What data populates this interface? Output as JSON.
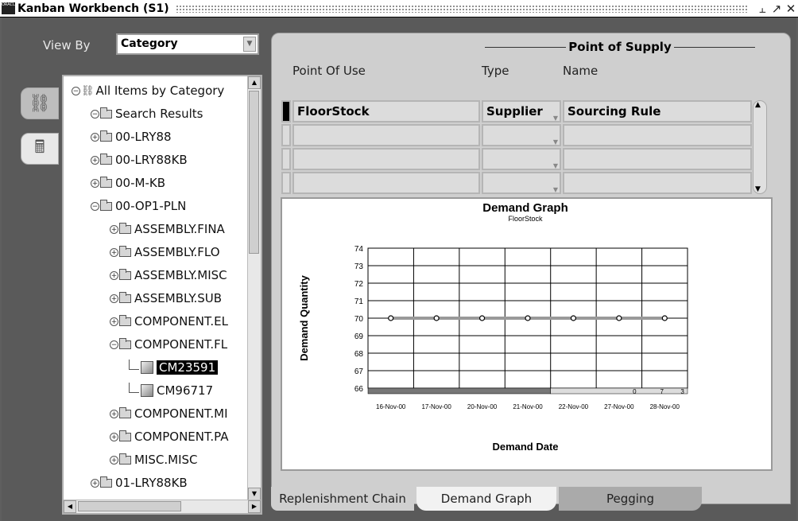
{
  "window": {
    "title": "Kanban Workbench (S1)",
    "logo_text": "ORACLE",
    "buttons": [
      "minimize",
      "restore",
      "close"
    ]
  },
  "view_by": {
    "label": "View By",
    "value": "Category"
  },
  "tree": {
    "items": [
      {
        "label": "All Items by Category",
        "indent": 0,
        "type": "root",
        "expander": "−"
      },
      {
        "label": "Search Results",
        "indent": 1,
        "type": "folder",
        "expander": "−"
      },
      {
        "label": "00-LRY88",
        "indent": 1,
        "type": "folder",
        "expander": "+"
      },
      {
        "label": "00-LRY88KB",
        "indent": 1,
        "type": "folder",
        "expander": "+"
      },
      {
        "label": "00-M-KB",
        "indent": 1,
        "type": "folder",
        "expander": "+"
      },
      {
        "label": "00-OP1-PLN",
        "indent": 1,
        "type": "folder",
        "expander": "−"
      },
      {
        "label": "ASSEMBLY.FINA",
        "indent": 2,
        "type": "folder",
        "expander": "+"
      },
      {
        "label": "ASSEMBLY.FLO",
        "indent": 2,
        "type": "folder",
        "expander": "+"
      },
      {
        "label": "ASSEMBLY.MISC",
        "indent": 2,
        "type": "folder",
        "expander": "+"
      },
      {
        "label": "ASSEMBLY.SUB",
        "indent": 2,
        "type": "folder",
        "expander": "+"
      },
      {
        "label": "COMPONENT.EL",
        "indent": 2,
        "type": "folder",
        "expander": "+"
      },
      {
        "label": "COMPONENT.FL",
        "indent": 2,
        "type": "folder",
        "expander": "−"
      },
      {
        "label": "CM23591",
        "indent": 3,
        "type": "item",
        "expander": "",
        "selected": true
      },
      {
        "label": "CM96717",
        "indent": 3,
        "type": "item",
        "expander": ""
      },
      {
        "label": "COMPONENT.MI",
        "indent": 2,
        "type": "folder",
        "expander": "+"
      },
      {
        "label": "COMPONENT.PA",
        "indent": 2,
        "type": "folder",
        "expander": "+"
      },
      {
        "label": "MISC.MISC",
        "indent": 2,
        "type": "folder",
        "expander": "+"
      },
      {
        "label": "01-LRY88KB",
        "indent": 1,
        "type": "folder",
        "expander": "+"
      }
    ]
  },
  "supply": {
    "group_header": "Point of Supply",
    "col_point_of_use": "Point Of Use",
    "col_type": "Type",
    "col_name": "Name",
    "rows": [
      {
        "point_of_use": "FloorStock",
        "type": "Supplier",
        "name": "Sourcing Rule"
      },
      {
        "point_of_use": "",
        "type": "",
        "name": ""
      },
      {
        "point_of_use": "",
        "type": "",
        "name": ""
      },
      {
        "point_of_use": "",
        "type": "",
        "name": ""
      }
    ]
  },
  "chart_data": {
    "type": "line",
    "title": "Demand Graph",
    "subtitle": "FloorStock",
    "xlabel": "Demand Date",
    "ylabel": "Demand Quantity",
    "categories": [
      "16-Nov-00",
      "17-Nov-00",
      "20-Nov-00",
      "21-Nov-00",
      "22-Nov-00",
      "27-Nov-00",
      "28-Nov-00"
    ],
    "series": [
      {
        "values": [
          70,
          70,
          70,
          70,
          70,
          70,
          70
        ]
      }
    ],
    "ylim": [
      66,
      74
    ],
    "yticks": [
      66,
      67,
      68,
      69,
      70,
      71,
      72,
      73,
      74
    ],
    "grid": true,
    "bottom_bar_labels": [
      "0",
      "7",
      "3"
    ]
  },
  "tabs": [
    {
      "label": "Replenishment Chain",
      "active": false
    },
    {
      "label": "Demand Graph",
      "active": true
    },
    {
      "label": "Pegging",
      "active": false
    }
  ]
}
